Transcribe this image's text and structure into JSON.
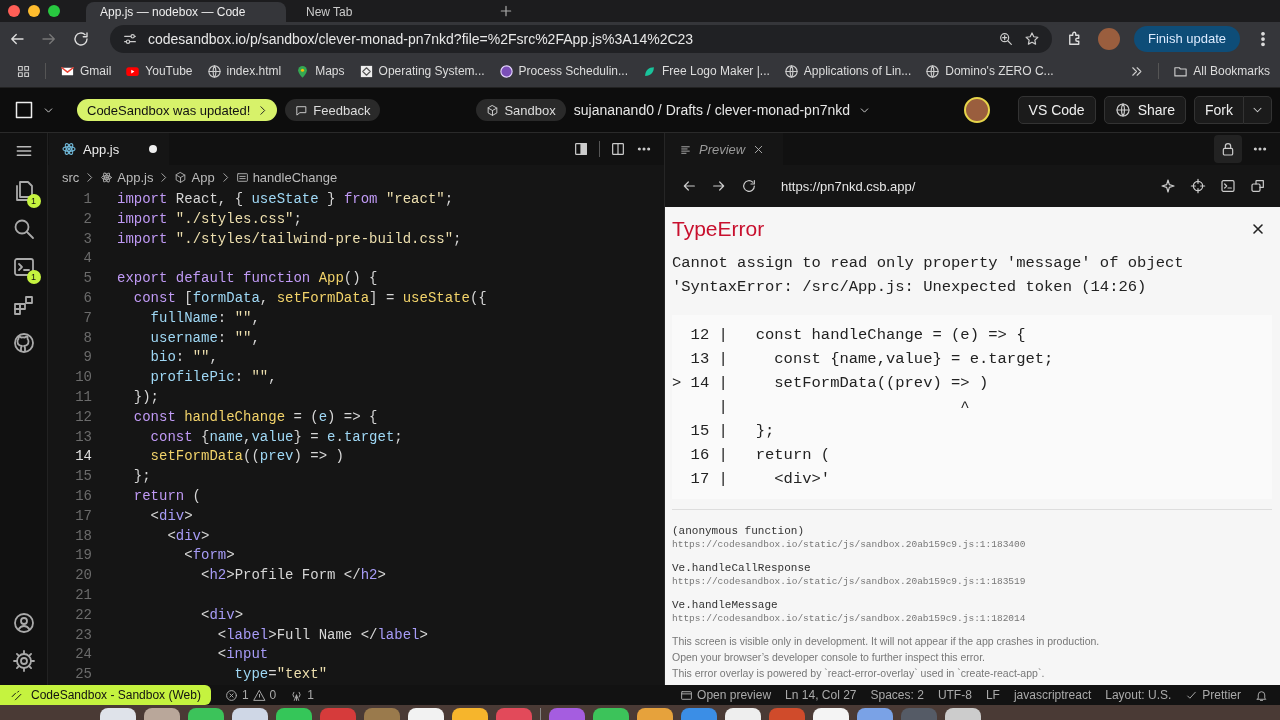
{
  "browser": {
    "tabs": [
      {
        "title": "App.js — nodebox — Code",
        "selected": true
      },
      {
        "title": "New Tab",
        "selected": false
      }
    ],
    "url": "codesandbox.io/p/sandbox/clever-monad-pn7nkd?file=%2Fsrc%2FApp.js%3A14%2C23",
    "update_button": "Finish update",
    "bookmarks": [
      {
        "label": "Gmail",
        "kind": "mail"
      },
      {
        "label": "YouTube",
        "kind": "video"
      },
      {
        "label": "index.html",
        "kind": "globe"
      },
      {
        "label": "Maps",
        "kind": "pin"
      },
      {
        "label": "Operating System...",
        "kind": "tile"
      },
      {
        "label": "Process Schedulin...",
        "kind": "badge"
      },
      {
        "label": "Free Logo Maker |...",
        "kind": "leaf"
      },
      {
        "label": "Applications of Lin...",
        "kind": "globe"
      },
      {
        "label": "Domino's ZERO C...",
        "kind": "globe"
      }
    ],
    "all_bookmarks": "All Bookmarks"
  },
  "header": {
    "update_badge": "CodeSandbox was updated!",
    "feedback": "Feedback",
    "sandbox": "Sandbox",
    "path": "sujananand0 / Drafts / clever-monad-pn7nkd",
    "buttons": [
      "VS Code",
      "Share",
      "Fork"
    ]
  },
  "activity_bar": {
    "top": [
      {
        "kind": "files",
        "badge": "1"
      },
      {
        "kind": "search"
      },
      {
        "kind": "terminal",
        "badge": "1"
      },
      {
        "kind": "extensions"
      },
      {
        "kind": "github"
      }
    ],
    "bottom": [
      {
        "kind": "account"
      },
      {
        "kind": "settings"
      }
    ]
  },
  "editor": {
    "tab": {
      "label": "App.js",
      "modified": true
    },
    "breadcrumb": [
      {
        "label": "src",
        "kind": "folder"
      },
      {
        "label": "App.js",
        "kind": "file"
      },
      {
        "label": "App",
        "kind": "component"
      },
      {
        "label": "handleChange",
        "kind": "symbol"
      }
    ],
    "lines": [
      {
        "number": "1",
        "current": false,
        "tokens": [
          {
            "kind": "k",
            "text": "import"
          },
          {
            "kind": "p",
            "text": " React, { "
          },
          {
            "kind": "v",
            "text": "useState"
          },
          {
            "kind": "p",
            "text": " } "
          },
          {
            "kind": "k",
            "text": "from"
          },
          {
            "kind": "s",
            "text": " \"react\""
          },
          {
            "kind": "p",
            "text": ";"
          }
        ]
      },
      {
        "number": "2",
        "current": false,
        "tokens": [
          {
            "kind": "k",
            "text": "import"
          },
          {
            "kind": "s",
            "text": " \"./styles.css\""
          },
          {
            "kind": "p",
            "text": ";"
          }
        ]
      },
      {
        "number": "3",
        "current": false,
        "tokens": [
          {
            "kind": "k",
            "text": "import"
          },
          {
            "kind": "s",
            "text": " \"./styles/tailwind-pre-build.css\""
          },
          {
            "kind": "p",
            "text": ";"
          }
        ]
      },
      {
        "number": "4",
        "current": false
      },
      {
        "number": "5",
        "current": false,
        "tokens": [
          {
            "kind": "k",
            "text": "export default function"
          },
          {
            "kind": "f",
            "text": " App"
          },
          {
            "kind": "p",
            "text": "() {"
          }
        ]
      },
      {
        "number": "6",
        "current": false,
        "tokens": [
          {
            "kind": "k",
            "text": "  const"
          },
          {
            "kind": "p",
            "text": " ["
          },
          {
            "kind": "v",
            "text": "formData"
          },
          {
            "kind": "p",
            "text": ", "
          },
          {
            "kind": "f",
            "text": "setFormData"
          },
          {
            "kind": "p",
            "text": "] = "
          },
          {
            "kind": "f",
            "text": "useState"
          },
          {
            "kind": "p",
            "text": "({"
          }
        ]
      },
      {
        "number": "7",
        "current": false,
        "tokens": [
          {
            "kind": "v",
            "text": "    fullName"
          },
          {
            "kind": "p",
            "text": ": "
          },
          {
            "kind": "s",
            "text": "\"\""
          },
          {
            "kind": "p",
            "text": ","
          }
        ]
      },
      {
        "number": "8",
        "current": false,
        "tokens": [
          {
            "kind": "v",
            "text": "    username"
          },
          {
            "kind": "p",
            "text": ": "
          },
          {
            "kind": "s",
            "text": "\"\""
          },
          {
            "kind": "p",
            "text": ","
          }
        ]
      },
      {
        "number": "9",
        "current": false,
        "tokens": [
          {
            "kind": "v",
            "text": "    bio"
          },
          {
            "kind": "p",
            "text": ": "
          },
          {
            "kind": "s",
            "text": "\"\""
          },
          {
            "kind": "p",
            "text": ","
          }
        ]
      },
      {
        "number": "10",
        "current": false,
        "tokens": [
          {
            "kind": "v",
            "text": "    profilePic"
          },
          {
            "kind": "p",
            "text": ": "
          },
          {
            "kind": "s",
            "text": "\"\""
          },
          {
            "kind": "p",
            "text": ","
          }
        ]
      },
      {
        "number": "11",
        "current": false,
        "tokens": [
          {
            "kind": "p",
            "text": "  });"
          }
        ]
      },
      {
        "number": "12",
        "current": false,
        "tokens": [
          {
            "kind": "k",
            "text": "  const"
          },
          {
            "kind": "f",
            "text": " handleChange"
          },
          {
            "kind": "p",
            "text": " = ("
          },
          {
            "kind": "v",
            "text": "e"
          },
          {
            "kind": "p",
            "text": ") => {"
          }
        ]
      },
      {
        "number": "13",
        "current": false,
        "tokens": [
          {
            "kind": "k",
            "text": "    const"
          },
          {
            "kind": "p",
            "text": " {"
          },
          {
            "kind": "v",
            "text": "name"
          },
          {
            "kind": "p",
            "text": ","
          },
          {
            "kind": "v",
            "text": "value"
          },
          {
            "kind": "p",
            "text": "} = "
          },
          {
            "kind": "v",
            "text": "e"
          },
          {
            "kind": "p",
            "text": "."
          },
          {
            "kind": "v",
            "text": "target"
          },
          {
            "kind": "p",
            "text": ";"
          }
        ]
      },
      {
        "number": "14",
        "current": true,
        "tokens": [
          {
            "kind": "f",
            "text": "    setFormData"
          },
          {
            "kind": "p",
            "text": "(("
          },
          {
            "kind": "v",
            "text": "prev"
          },
          {
            "kind": "p",
            "text": ") => )"
          }
        ]
      },
      {
        "number": "15",
        "current": false,
        "tokens": [
          {
            "kind": "p",
            "text": "  };"
          }
        ]
      },
      {
        "number": "16",
        "current": false,
        "tokens": [
          {
            "kind": "k",
            "text": "  return"
          },
          {
            "kind": "p",
            "text": " ("
          }
        ]
      },
      {
        "number": "17",
        "current": false,
        "tokens": [
          {
            "kind": "p",
            "text": "    <"
          },
          {
            "kind": "t",
            "text": "div"
          },
          {
            "kind": "p",
            "text": ">"
          }
        ]
      },
      {
        "number": "18",
        "current": false,
        "tokens": [
          {
            "kind": "p",
            "text": "      <"
          },
          {
            "kind": "t",
            "text": "div"
          },
          {
            "kind": "p",
            "text": ">"
          }
        ]
      },
      {
        "number": "19",
        "current": false,
        "tokens": [
          {
            "kind": "p",
            "text": "        <"
          },
          {
            "kind": "t",
            "text": "form"
          },
          {
            "kind": "p",
            "text": ">"
          }
        ]
      },
      {
        "number": "20",
        "current": false,
        "tokens": [
          {
            "kind": "p",
            "text": "          <"
          },
          {
            "kind": "t",
            "text": "h2"
          },
          {
            "kind": "p",
            "text": ">Profile Form </"
          },
          {
            "kind": "t",
            "text": "h2"
          },
          {
            "kind": "p",
            "text": ">"
          }
        ]
      },
      {
        "number": "21",
        "current": false
      },
      {
        "number": "22",
        "current": false,
        "tokens": [
          {
            "kind": "p",
            "text": "          <"
          },
          {
            "kind": "t",
            "text": "div"
          },
          {
            "kind": "p",
            "text": ">"
          }
        ]
      },
      {
        "number": "23",
        "current": false,
        "tokens": [
          {
            "kind": "p",
            "text": "            <"
          },
          {
            "kind": "t",
            "text": "label"
          },
          {
            "kind": "p",
            "text": ">Full Name </"
          },
          {
            "kind": "t",
            "text": "label"
          },
          {
            "kind": "p",
            "text": ">"
          }
        ]
      },
      {
        "number": "24",
        "current": false,
        "tokens": [
          {
            "kind": "p",
            "text": "            <"
          },
          {
            "kind": "t",
            "text": "input"
          }
        ]
      },
      {
        "number": "25",
        "current": false,
        "tokens": [
          {
            "kind": "v",
            "text": "              type"
          },
          {
            "kind": "p",
            "text": "="
          },
          {
            "kind": "s",
            "text": "\"text\""
          }
        ]
      }
    ]
  },
  "preview": {
    "tab": "Preview",
    "url": "https://pn7nkd.csb.app/",
    "error": {
      "title": "TypeError",
      "message": "Cannot assign to read only property 'message' of object 'SyntaxError: /src/App.js: Unexpected token (14:26)",
      "frame": [
        "  12 |   const handleChange = (e) => {",
        "  13 |     const {name,value} = e.target;",
        "> 14 |     setFormData((prev) => )",
        "     |                         ^",
        "  15 |   };",
        "  16 |   return (",
        "  17 |     <div>'"
      ],
      "stack": [
        {
          "name": "(anonymous function)",
          "url": "https://codesandbox.io/static/js/sandbox.20ab159c9.js:1:183400"
        },
        {
          "name": "Ve.handleCallResponse",
          "url": "https://codesandbox.io/static/js/sandbox.20ab159c9.js:1:183519"
        },
        {
          "name": "Ve.handleMessage",
          "url": "https://codesandbox.io/static/js/sandbox.20ab159c9.js:1:182014"
        }
      ],
      "footer": [
        "This screen is visible only in development. It will not appear if the app crashes in production.",
        "Open your browser’s developer console to further inspect this error.",
        "This error overlay is powered by `react-error-overlay` used in `create-react-app`."
      ]
    }
  },
  "status_bar": {
    "remote": "CodeSandbox - Sandbox (Web)",
    "errors": "1",
    "warnings": "0",
    "ports": "1",
    "items": [
      {
        "label": "Open preview",
        "kind": "preview"
      },
      {
        "label": "Ln 14, Col 27",
        "kind": "text"
      },
      {
        "label": "Spaces: 2",
        "kind": "text"
      },
      {
        "label": "UTF-8",
        "kind": "text"
      },
      {
        "label": "LF",
        "kind": "text"
      },
      {
        "label": "javascriptreact",
        "kind": "text"
      },
      {
        "label": "Layout: U.S.",
        "kind": "text"
      },
      {
        "label": "Prettier",
        "kind": "check"
      }
    ]
  }
}
